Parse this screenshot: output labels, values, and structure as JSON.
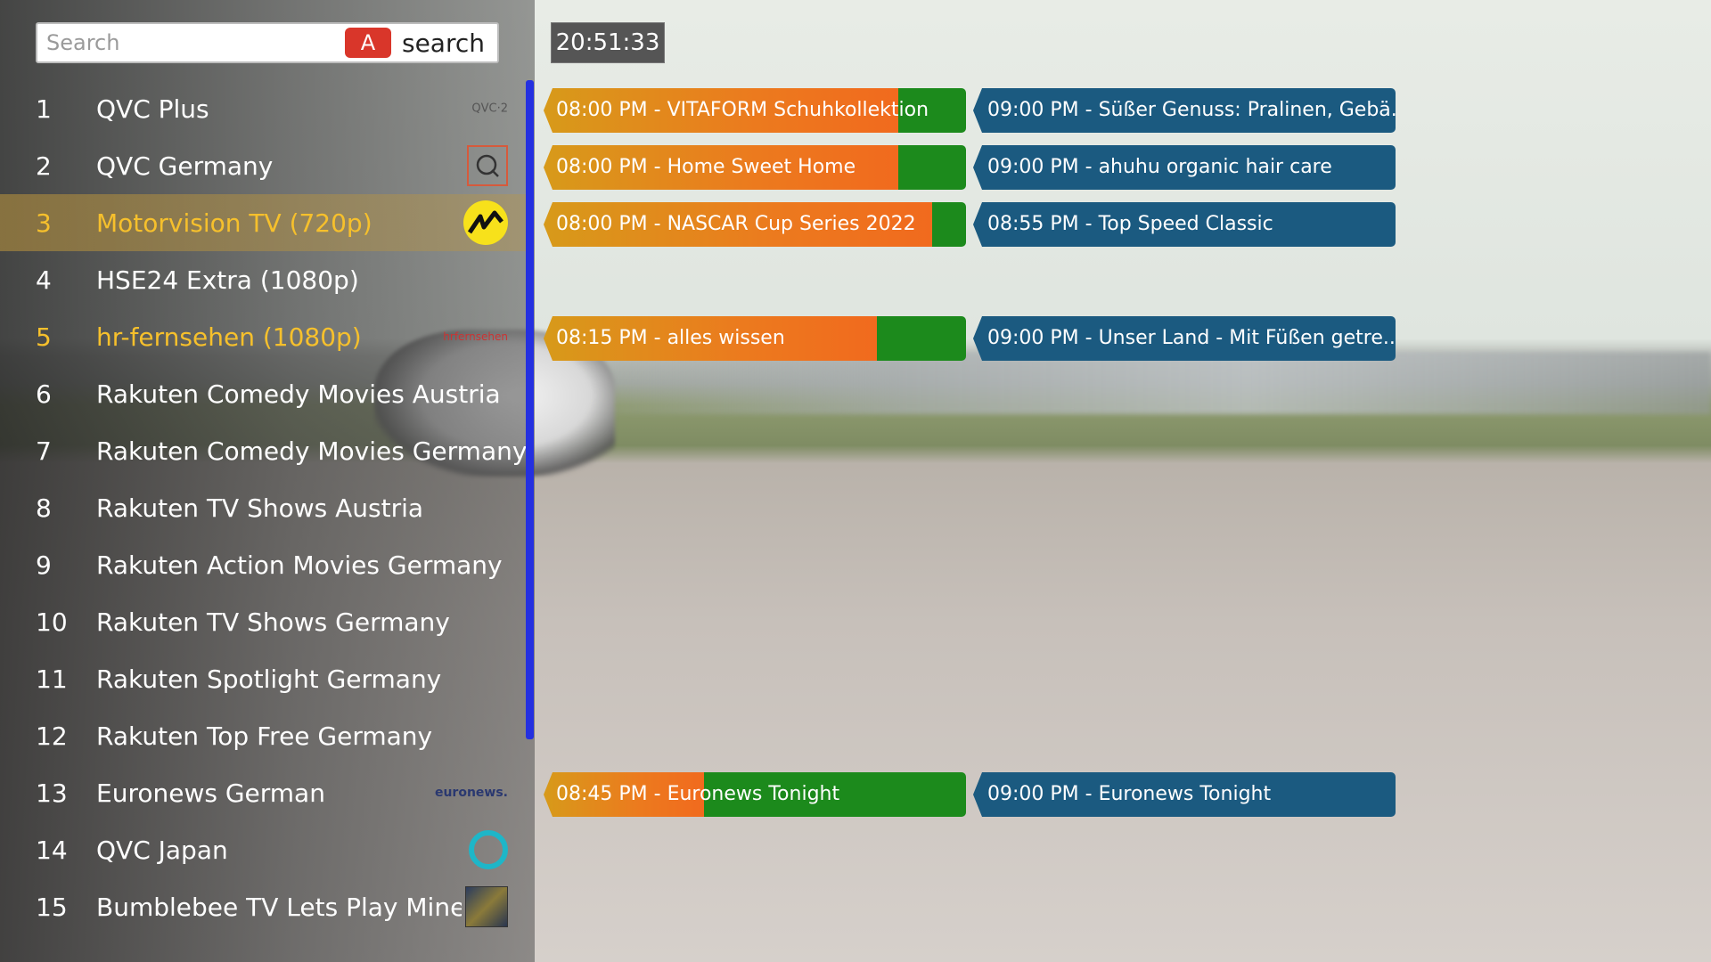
{
  "search": {
    "placeholder": "Search",
    "key_label": "A",
    "button_label": "search"
  },
  "clock": "20:51:33",
  "channels": [
    {
      "num": "1",
      "name": "QVC Plus",
      "logo": "qvc-2-logo",
      "logo_text": "QVC·2"
    },
    {
      "num": "2",
      "name": "QVC Germany",
      "logo": "qvc-logo"
    },
    {
      "num": "3",
      "name": "Motorvision TV (720p)",
      "logo": "motorvision-logo"
    },
    {
      "num": "4",
      "name": "HSE24 Extra (1080p)",
      "logo": ""
    },
    {
      "num": "5",
      "name": "hr-fernsehen (1080p)",
      "logo": "hr-fernsehen-logo",
      "logo_text": "hrfernsehen"
    },
    {
      "num": "6",
      "name": "Rakuten Comedy Movies Austria",
      "logo": ""
    },
    {
      "num": "7",
      "name": "Rakuten Comedy Movies Germany",
      "logo": ""
    },
    {
      "num": "8",
      "name": "Rakuten TV Shows Austria",
      "logo": ""
    },
    {
      "num": "9",
      "name": "Rakuten Action Movies Germany",
      "logo": ""
    },
    {
      "num": "10",
      "name": "Rakuten TV Shows Germany",
      "logo": ""
    },
    {
      "num": "11",
      "name": "Rakuten Spotlight Germany",
      "logo": ""
    },
    {
      "num": "12",
      "name": "Rakuten Top Free Germany",
      "logo": ""
    },
    {
      "num": "13",
      "name": "Euronews German",
      "logo": "euronews-logo",
      "logo_text": "euronews."
    },
    {
      "num": "14",
      "name": "QVC Japan",
      "logo": "qvc-japan-logo"
    },
    {
      "num": "15",
      "name": "Bumblebee TV Lets Play Mine...",
      "logo": "bumblebee-logo"
    }
  ],
  "epg": [
    {
      "channel": "1",
      "now": "08:00 PM - VITAFORM Schuhkollektion",
      "progress": 0.84,
      "next": "09:00 PM - Süßer Genuss: Pralinen, Gebä..."
    },
    {
      "channel": "2",
      "now": "08:00 PM - Home Sweet Home",
      "progress": 0.84,
      "next": "09:00 PM - ahuhu organic hair care"
    },
    {
      "channel": "3",
      "now": "08:00 PM - NASCAR Cup Series 2022",
      "progress": 0.92,
      "next": "08:55 PM - Top Speed Classic"
    },
    {
      "channel": "5",
      "now": "08:15 PM - alles wissen",
      "progress": 0.79,
      "next": "09:00 PM - Unser Land - Mit Füßen getre..."
    },
    {
      "channel": "13",
      "now": "08:45 PM - Euronews Tonight",
      "progress": 0.38,
      "next": "09:00 PM - Euronews Tonight"
    }
  ],
  "colors": {
    "selected_text": "#f6c02c",
    "progress_elapsed": "#ec7a1e",
    "progress_remaining": "#1c8a1c",
    "next_program": "#1b5a80",
    "scrollbar": "#2430e0",
    "search_key": "#d9362a"
  }
}
